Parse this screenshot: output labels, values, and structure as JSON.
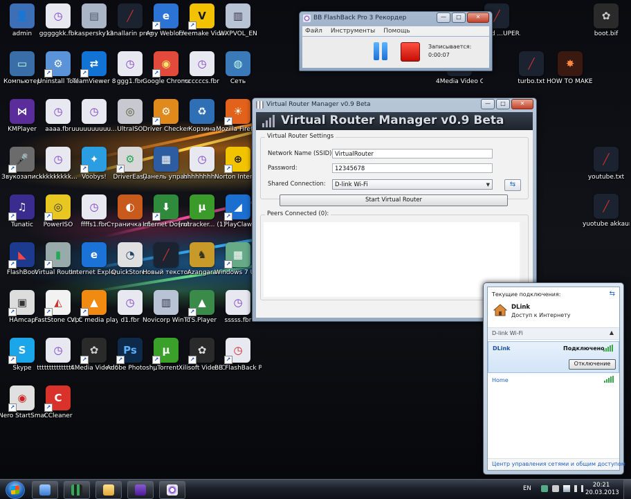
{
  "desktop": {
    "icons": [
      {
        "name": "desktop-icon-admin",
        "label": "admin",
        "bg": "#3d6fb7",
        "glyph": "👤",
        "color": "#fff"
      },
      {
        "name": "desktop-icon-ggggkk",
        "label": "gggggkk.fbr",
        "bg": "#e8e8f0",
        "glyph": "◷",
        "color": "#7a39c4",
        "shortcut": false
      },
      {
        "name": "desktop-icon-kaspersky",
        "label": "kaspersky13",
        "bg": "#aab6c8",
        "glyph": "▤",
        "color": "#4a5a6d"
      },
      {
        "name": "desktop-icon-kanallarin",
        "label": "kanallarin programi.txt",
        "bg": "#1c2330",
        "glyph": "╱",
        "color": "#c8332a"
      },
      {
        "name": "desktop-icon-any-weblock",
        "label": "Any Weblock",
        "bg": "#2b74d6",
        "glyph": "e",
        "color": "#fff",
        "shortcut": true
      },
      {
        "name": "desktop-icon-freemake",
        "label": "Freemake Video C...",
        "bg": "#f2c200",
        "glyph": "V",
        "color": "#1a1a1a",
        "shortcut": true
      },
      {
        "name": "desktop-icon-wxpvol",
        "label": "WXPVOL_EN",
        "bg": "#b8c4d6",
        "glyph": "▥",
        "color": "#334"
      },
      {
        "name": "desktop-icon-computer",
        "label": "Компьютер",
        "bg": "#3a6ea8",
        "glyph": "▭",
        "color": "#cfe"
      },
      {
        "name": "desktop-icon-uninstall-tool",
        "label": "Uninstall Tool",
        "bg": "#5a93d8",
        "glyph": "⚙",
        "color": "#fff",
        "shortcut": true
      },
      {
        "name": "desktop-icon-teamviewer",
        "label": "TeamViewer 8",
        "bg": "#1273d6",
        "glyph": "⇄",
        "color": "#fff",
        "shortcut": true
      },
      {
        "name": "desktop-icon-ggg1",
        "label": "ggg1.fbr",
        "bg": "#e8e8f0",
        "glyph": "◷",
        "color": "#7a39c4"
      },
      {
        "name": "desktop-icon-google-chrome",
        "label": "Google Chrome",
        "bg": "#e24a3b",
        "glyph": "◉",
        "color": "#fce66a",
        "shortcut": true
      },
      {
        "name": "desktop-icon-ccccccs",
        "label": "ccccccs.fbr",
        "bg": "#e8e8f0",
        "glyph": "◷",
        "color": "#7a39c4"
      },
      {
        "name": "desktop-icon-network",
        "label": "Сеть",
        "bg": "#3a7ab8",
        "glyph": "◍",
        "color": "#cfe"
      },
      {
        "name": "desktop-icon-kmplayer",
        "label": "KMPlayer",
        "bg": "#5a2d9a",
        "glyph": "⋈",
        "color": "#fff"
      },
      {
        "name": "desktop-icon-aaaa",
        "label": "aaaa.fbr",
        "bg": "#e8e8f0",
        "glyph": "◷",
        "color": "#7a39c4"
      },
      {
        "name": "desktop-icon-uuuuuuuu",
        "label": "uuuuuuuuuu...",
        "bg": "#e8e8f0",
        "glyph": "◷",
        "color": "#7a39c4"
      },
      {
        "name": "desktop-icon-ultraiso",
        "label": "UltraISO",
        "bg": "#c8c8d0",
        "glyph": "◎",
        "color": "#553"
      },
      {
        "name": "desktop-icon-driver-checker",
        "label": "Driver Checker",
        "bg": "#e08a1c",
        "glyph": "⚙",
        "color": "#fff",
        "shortcut": true
      },
      {
        "name": "desktop-icon-recycle-bin",
        "label": "Корзина",
        "bg": "#2e6fb6",
        "glyph": "♻",
        "color": "#fff"
      },
      {
        "name": "desktop-icon-mozilla-firefox",
        "label": "Mozilla Firefox",
        "bg": "#e2621b",
        "glyph": "☀",
        "color": "#ffe",
        "shortcut": true
      },
      {
        "name": "desktop-icon-sound-recorder",
        "label": "Звукозапись",
        "bg": "#6b6b6b",
        "glyph": "🎤",
        "color": "#fff",
        "shortcut": true
      },
      {
        "name": "desktop-icon-kkkkkkkkk",
        "label": "kkkkkkkkk...",
        "bg": "#e8e8f0",
        "glyph": "◷",
        "color": "#7a39c4"
      },
      {
        "name": "desktop-icon-voobys",
        "label": "Voobys!",
        "bg": "#2a9ee0",
        "glyph": "✦",
        "color": "#fff",
        "shortcut": true
      },
      {
        "name": "desktop-icon-drivereasy",
        "label": "DriverEasy",
        "bg": "#d8d8d8",
        "glyph": "⚙",
        "color": "#2a5",
        "shortcut": true
      },
      {
        "name": "desktop-icon-control-panel",
        "label": "Панель управления",
        "bg": "#2d5da0",
        "glyph": "▦",
        "color": "#fff"
      },
      {
        "name": "desktop-icon-hhhhhhhh",
        "label": "hhhhhhhh...",
        "bg": "#e8e8f0",
        "glyph": "◷",
        "color": "#7a39c4"
      },
      {
        "name": "desktop-icon-norton",
        "label": "Norton Intern...",
        "bg": "#f2c400",
        "glyph": "⊕",
        "color": "#1a1a1a",
        "shortcut": true
      },
      {
        "name": "desktop-icon-tunatic",
        "label": "Tunatic",
        "bg": "#3a2c8e",
        "glyph": "♫",
        "color": "#fff",
        "shortcut": true
      },
      {
        "name": "desktop-icon-poweriso",
        "label": "PowerISO",
        "bg": "#e8c820",
        "glyph": "◎",
        "color": "#333",
        "shortcut": true
      },
      {
        "name": "desktop-icon-ffffs1",
        "label": "ffffs1.fbr",
        "bg": "#e8e8f0",
        "glyph": "◷",
        "color": "#7a39c4"
      },
      {
        "name": "desktop-icon-frame-page",
        "label": "Страничка сборщика",
        "bg": "#c85a1c",
        "glyph": "◐",
        "color": "#fff"
      },
      {
        "name": "desktop-icon-internet-download",
        "label": "Internet Downlo...",
        "bg": "#2f8a3c",
        "glyph": "⬇",
        "color": "#fff",
        "shortcut": true
      },
      {
        "name": "desktop-icon-rutracker",
        "label": "[rutracker... (1).torrent",
        "bg": "#3a9a2a",
        "glyph": "µ",
        "color": "#fff"
      },
      {
        "name": "desktop-icon-playclaw",
        "label": "PlayClaw",
        "bg": "#1a6fd0",
        "glyph": "◢",
        "color": "#fff",
        "shortcut": true
      },
      {
        "name": "desktop-icon-flashboot",
        "label": "FlashBoot",
        "bg": "#1c3a8e",
        "glyph": "◣",
        "color": "#f44",
        "shortcut": true
      },
      {
        "name": "desktop-icon-virtual-router",
        "label": "Virtual Router ...",
        "bg": "#9aa",
        "glyph": "▮",
        "color": "#2a5",
        "shortcut": true
      },
      {
        "name": "desktop-icon-internet-explorer",
        "label": "Internet Explorer",
        "bg": "#1b73d8",
        "glyph": "e",
        "color": "#fff"
      },
      {
        "name": "desktop-icon-quickstores",
        "label": "QuickStores",
        "bg": "#e0e0e0",
        "glyph": "◔",
        "color": "#246"
      },
      {
        "name": "desktop-icon-new-text-doc",
        "label": "Новый текстовый...",
        "bg": "#1c2330",
        "glyph": "╱",
        "color": "#c8332a"
      },
      {
        "name": "desktop-icon-azangara",
        "label": "Azangara",
        "bg": "#c89a2a",
        "glyph": "♞",
        "color": "#332"
      },
      {
        "name": "desktop-icon-windows7-usb",
        "label": "Windows 7 USB DVD...",
        "bg": "#6a8",
        "glyph": "▦",
        "color": "#fff",
        "shortcut": true
      },
      {
        "name": "desktop-icon-hamcap",
        "label": "HAmcap",
        "bg": "#ddd",
        "glyph": "▣",
        "color": "#333",
        "shortcut": true
      },
      {
        "name": "desktop-icon-faststone",
        "label": "FastStone Capture",
        "bg": "#f2f2f2",
        "glyph": "◭",
        "color": "#c33",
        "shortcut": true
      },
      {
        "name": "desktop-icon-vlc",
        "label": "VLC media player",
        "bg": "#f08a10",
        "glyph": "▲",
        "color": "#fff",
        "shortcut": true
      },
      {
        "name": "desktop-icon-d1",
        "label": "d1.fbr",
        "bg": "#e8e8f0",
        "glyph": "◷",
        "color": "#7a39c4"
      },
      {
        "name": "desktop-icon-novicorp",
        "label": "Novicorp WinToFlas...",
        "bg": "#b8c4d6",
        "glyph": "▥",
        "color": "#334"
      },
      {
        "name": "desktop-icon-ts-player",
        "label": "TS.Player",
        "bg": "#3a8a4a",
        "glyph": "▲",
        "color": "#fff",
        "shortcut": true
      },
      {
        "name": "desktop-icon-sssss",
        "label": "sssss.fbr",
        "bg": "#e8e8f0",
        "glyph": "◷",
        "color": "#7a39c4"
      },
      {
        "name": "desktop-icon-skype",
        "label": "Skype",
        "bg": "#1aa6e8",
        "glyph": "S",
        "color": "#fff",
        "shortcut": true
      },
      {
        "name": "desktop-icon-tttttttt",
        "label": "ttttttttttttttt...",
        "bg": "#e8e8f0",
        "glyph": "◷",
        "color": "#7a39c4"
      },
      {
        "name": "desktop-icon-4media-1",
        "label": "4Media Video C...",
        "bg": "#2a2a2a",
        "glyph": "✿",
        "color": "#ccc",
        "shortcut": true
      },
      {
        "name": "desktop-icon-adobe-photoshop",
        "label": "Adobe Photosh...",
        "bg": "#0d2a4a",
        "glyph": "Ps",
        "color": "#5ab0ff",
        "shortcut": true
      },
      {
        "name": "desktop-icon-utorrent",
        "label": "µTorrent",
        "bg": "#3aa02a",
        "glyph": "µ",
        "color": "#fff",
        "shortcut": true
      },
      {
        "name": "desktop-icon-xilisoft",
        "label": "Xilisoft Video Converter ...",
        "bg": "#2a2a2a",
        "glyph": "✿",
        "color": "#ddd",
        "shortcut": true
      },
      {
        "name": "desktop-icon-bb-flashback",
        "label": "BB FlashBack Pro 3 Recor...",
        "bg": "#e8e8f0",
        "glyph": "◷",
        "color": "#c22",
        "shortcut": true
      },
      {
        "name": "desktop-icon-nero",
        "label": "Nero StartSmart",
        "bg": "#e0e0e0",
        "glyph": "◉",
        "color": "#c22",
        "shortcut": true
      },
      {
        "name": "desktop-icon-ccleaner",
        "label": "CCleaner",
        "bg": "#d8322a",
        "glyph": "C",
        "color": "#fff",
        "shortcut": true
      }
    ],
    "right_icons": [
      {
        "name": "desktop-icon-bit-super",
        "label": "bit and ...UPER.txt",
        "bg": "#1c2330",
        "glyph": "╱",
        "color": "#c8332a"
      },
      {
        "name": "desktop-icon-boot-bif",
        "label": "boot.bif",
        "bg": "#2a2a2a",
        "glyph": "✿",
        "color": "#ccc"
      },
      {
        "name": "desktop-icon-4media-2",
        "label": "4Media Video Con...",
        "bg": "#1c2330",
        "glyph": "╱",
        "color": "#c8332a"
      },
      {
        "name": "desktop-icon-turbo",
        "label": "turbo.txt",
        "bg": "#1c2330",
        "glyph": "╱",
        "color": "#c8332a"
      },
      {
        "name": "desktop-icon-how-to",
        "label": "HOW TO MAKE YOU...",
        "bg": "#3a1a10",
        "glyph": "✸",
        "color": "#f84"
      },
      {
        "name": "desktop-icon-youtube",
        "label": "youtube.txt",
        "bg": "#1c2330",
        "glyph": "╱",
        "color": "#c8332a"
      },
      {
        "name": "desktop-icon-yuotube",
        "label": "yuotube akkaunt qa...",
        "bg": "#1c2330",
        "glyph": "╱",
        "color": "#c8332a"
      }
    ]
  },
  "flashback": {
    "title": "BB FlashBack Pro 3 Рекордер",
    "menu": [
      "Файл",
      "Инструменты",
      "Помощь"
    ],
    "recording_label": "Записывается:",
    "recording_time": "0:00:07"
  },
  "vrm": {
    "title": "Virtual Router Manager v0.9 Beta",
    "header": "Virtual Router Manager v0.9 Beta",
    "settings_caption": "Virtual Router Settings",
    "ssid_label": "Network Name (SSID):",
    "ssid_value": "VirtualRouter",
    "password_label": "Password:",
    "password_value": "12345678",
    "shared_label": "Shared Connection:",
    "shared_value": "D-link Wi-Fi",
    "start_button": "Start Virtual Router",
    "peers_caption": "Peers Connected (0):"
  },
  "network": {
    "title": "Текущие подключения:",
    "current_name": "DLink",
    "current_status": "Доступ к Интернету",
    "section_label": "D-link Wi-Fi",
    "net1_name": "DLink",
    "net1_status": "Подключено",
    "disconnect_button": "Отключение",
    "net2_name": "Home",
    "footer_link": "Центр управления сетями и общим доступом"
  },
  "taskbar": {
    "language": "EN",
    "time": "20:21",
    "date": "20.03.2013"
  },
  "colors": {
    "accent": "#1f5fbf",
    "signal": "#3aa84a",
    "record": "#e3170a",
    "pause": "#2a8af0"
  }
}
